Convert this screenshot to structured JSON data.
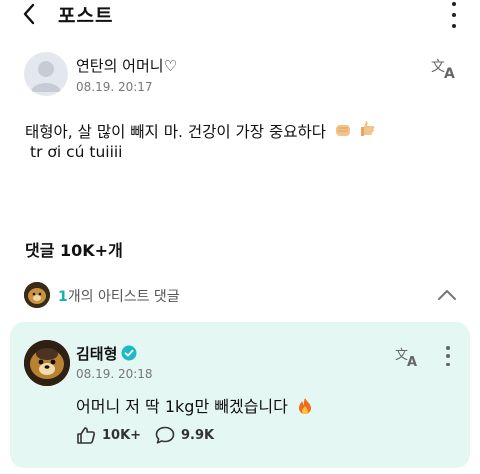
{
  "header": {
    "title": "포스트"
  },
  "post": {
    "author": "연탄의 어머니♡",
    "time": "08.19. 20:17",
    "line1": "태형아, 살 많이 빼지 마.  건강이 가장 중요하다",
    "line2": "tr ơi cú tuiiii"
  },
  "comments": {
    "header": "댓글 10K+개",
    "artist_count": "1",
    "artist_suffix": "개의 아티스트 댓글"
  },
  "artist_comment": {
    "name": "김태형",
    "time": "08.19. 20:18",
    "text": "어머니 저 딱 1kg만 빼겠습니다",
    "likes": "10K+",
    "replies": "9.9K"
  },
  "colors": {
    "accent": "#12b5ad",
    "card_bg": "#e5f7f3",
    "verified": "#1fb8c6"
  },
  "icons": [
    "back-arrow-icon",
    "more-vert-icon",
    "translate-icon",
    "chevron-up-icon",
    "verified-badge-icon",
    "like-icon",
    "reply-icon",
    "fist-emoji-icon",
    "thumbs-up-emoji-icon",
    "fire-emoji-icon"
  ]
}
